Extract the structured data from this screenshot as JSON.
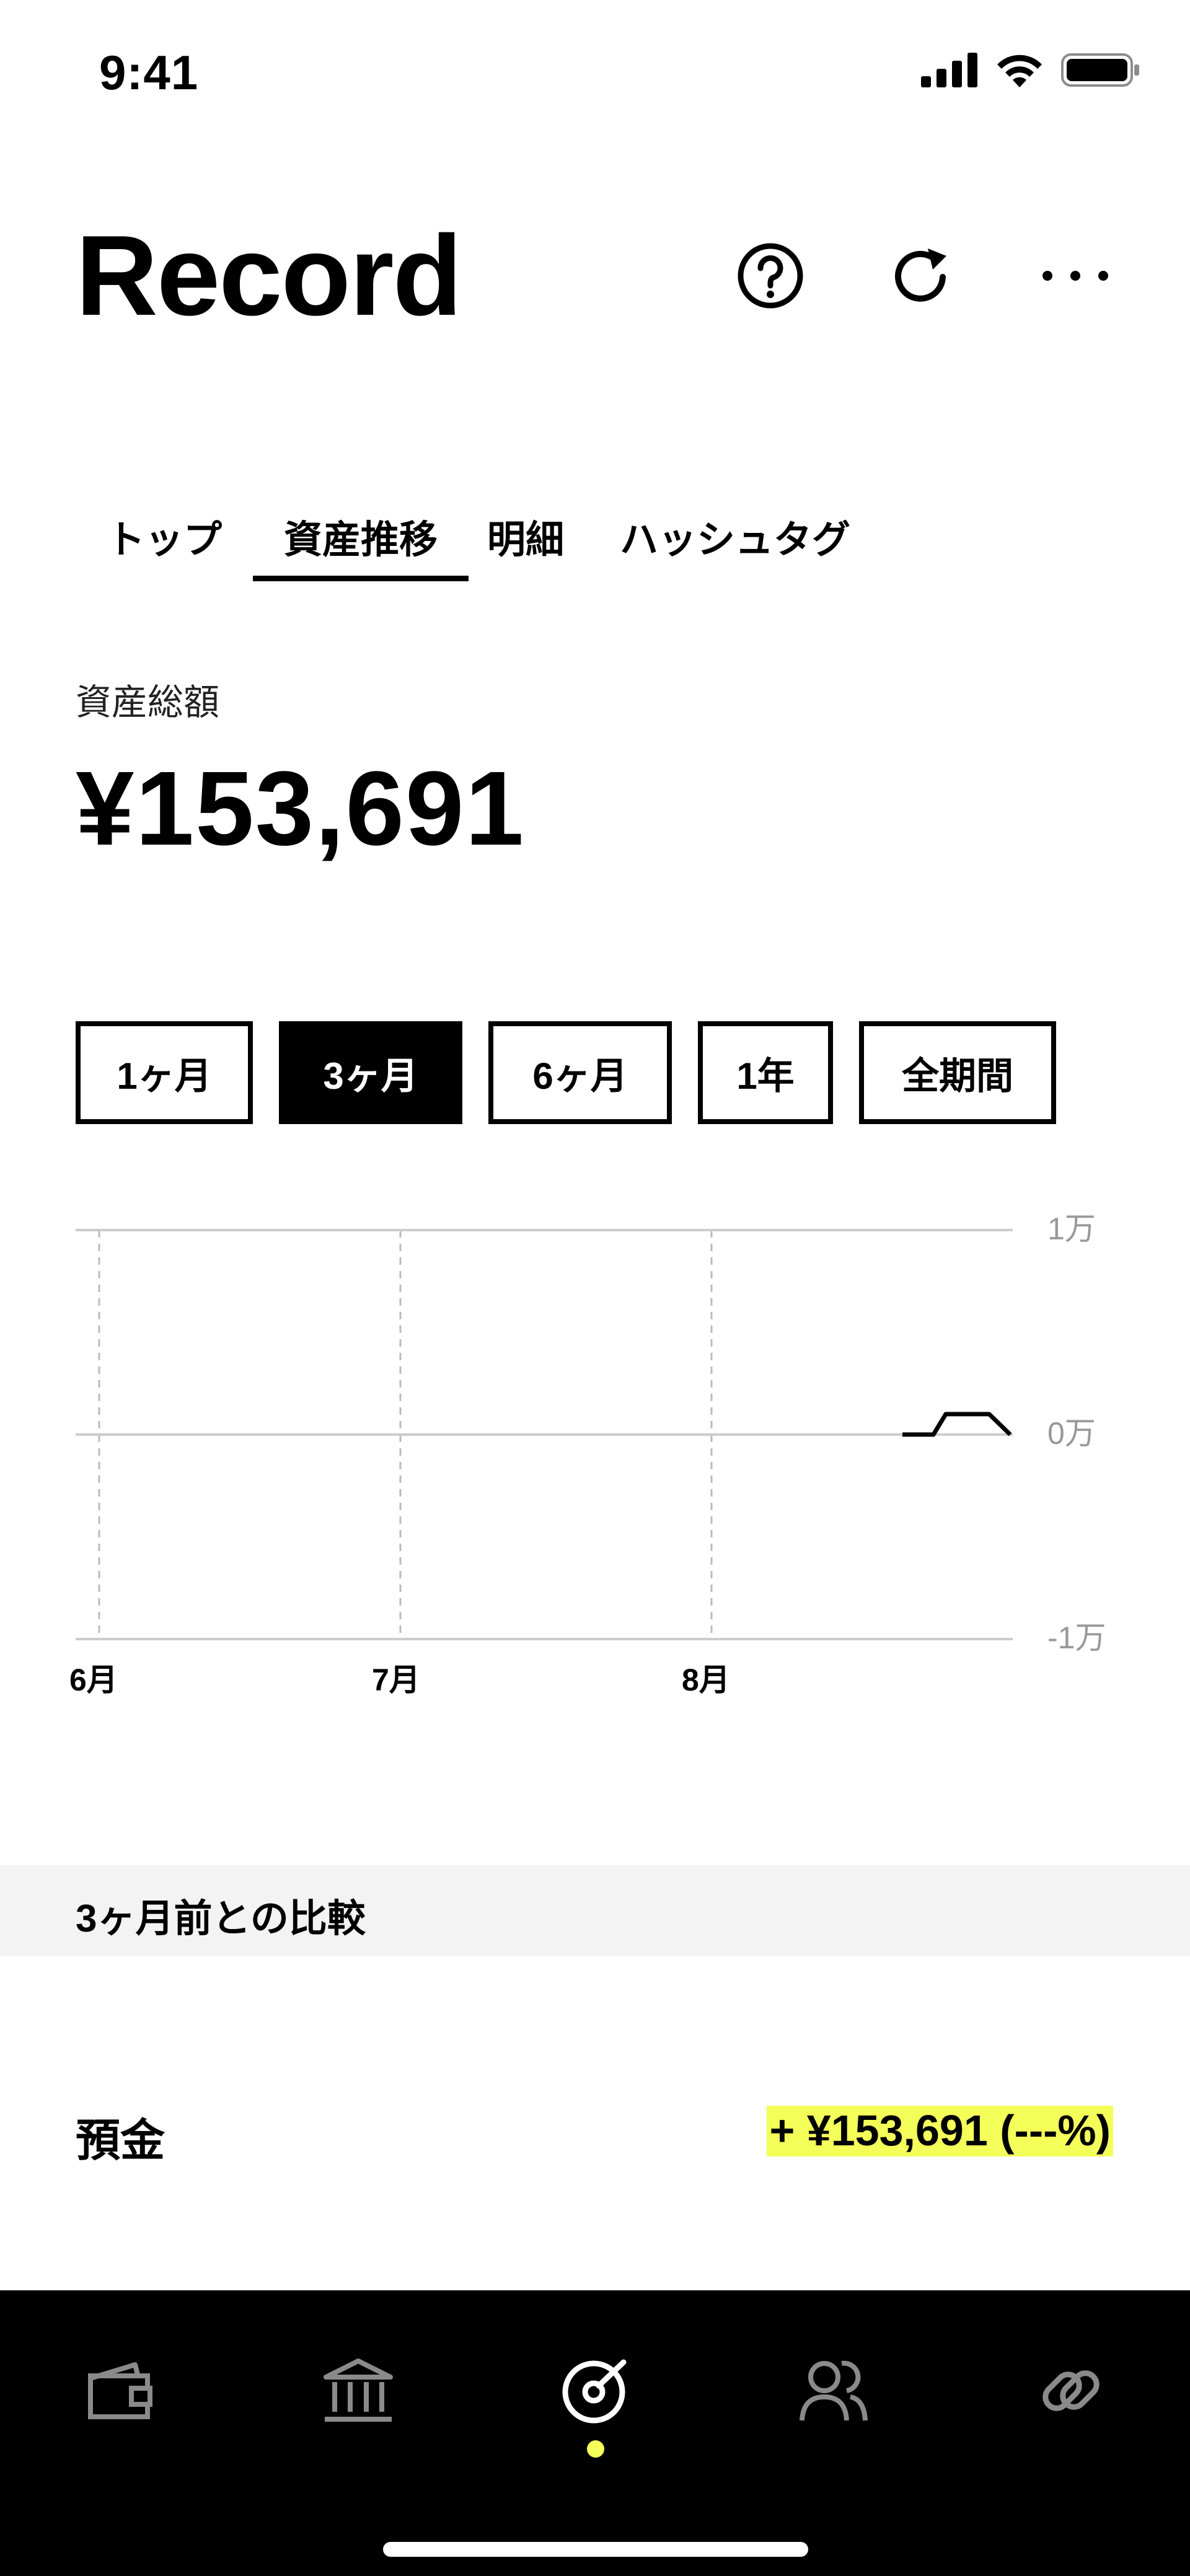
{
  "status_bar": {
    "time": "9:41"
  },
  "header": {
    "title": "Record",
    "icons": [
      "help-icon",
      "refresh-icon",
      "more-icon"
    ]
  },
  "tabs": [
    {
      "label": "トップ",
      "active": false
    },
    {
      "label": "資産推移",
      "active": true
    },
    {
      "label": "明細",
      "active": false
    },
    {
      "label": "ハッシュタグ",
      "active": false
    }
  ],
  "summary": {
    "label": "資産総額",
    "value": "¥153,691"
  },
  "periods": [
    {
      "label": "1ヶ月",
      "active": false
    },
    {
      "label": "3ヶ月",
      "active": true
    },
    {
      "label": "6ヶ月",
      "active": false
    },
    {
      "label": "1年",
      "active": false
    },
    {
      "label": "全期間",
      "active": false
    }
  ],
  "chart_data": {
    "type": "line",
    "x_tick_labels": [
      "6月",
      "7月",
      "8月"
    ],
    "y_tick_labels": [
      "1万",
      "0万",
      "-1万"
    ],
    "ylim": [
      -1,
      1
    ],
    "grid": true,
    "series": [
      {
        "values": [
          0,
          0,
          0.1,
          0.1,
          0
        ]
      }
    ],
    "line_color": "#000000"
  },
  "comparison": {
    "title": "3ヶ月前との比較",
    "rows": [
      {
        "label": "預金",
        "value": "+ ¥153,691 (---%)"
      }
    ],
    "highlight_color": "#f4ff5a"
  },
  "bottom_nav": {
    "items": [
      "wallet-icon",
      "bank-icon",
      "record-icon",
      "people-icon",
      "link-icon"
    ],
    "active_index": 2,
    "accent_color": "#f4ff5a"
  }
}
